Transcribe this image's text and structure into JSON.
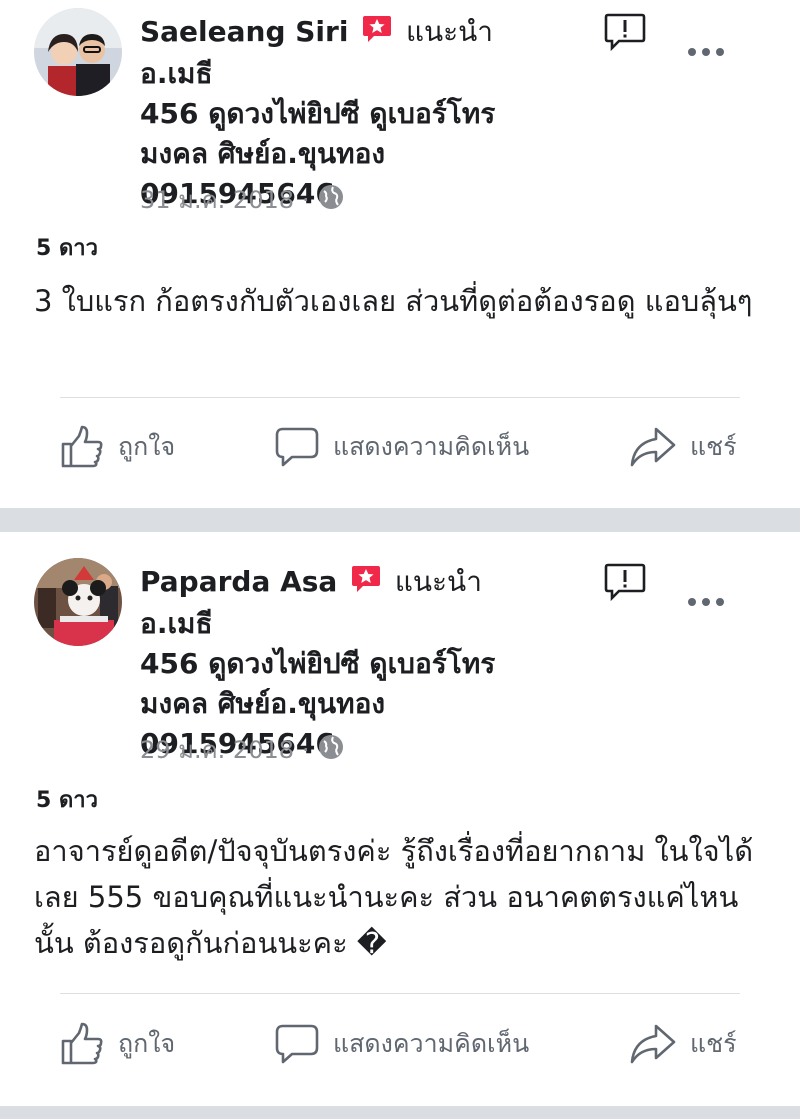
{
  "posts": [
    {
      "author": "Saeleang Siri",
      "recommend_word": "แนะนำ",
      "page_name_lines": [
        "อ.เมธี",
        "456 ดูดวงไพ่ยิปซี ดูเบอร์โทร",
        "มงคล ศิษย์อ.ขุนทอง",
        "0915945646"
      ],
      "date": "31 ม.ค. 2018",
      "separator": "·",
      "rating": "5 ดาว",
      "text": "3 ใบแรก ก้อตรงกับตัวเองเลย ส่วนที่ดูต่อต้องรอดู แอบลุ้นๆ",
      "actions": {
        "like": "ถูกใจ",
        "comment": "แสดงความคิดเห็น",
        "share": "แชร์"
      }
    },
    {
      "author": "Paparda Asa",
      "recommend_word": "แนะนำ",
      "page_name_lines": [
        "อ.เมธี",
        "456 ดูดวงไพ่ยิปซี ดูเบอร์โทร",
        "มงคล ศิษย์อ.ขุนทอง",
        "0915945646"
      ],
      "date": "29 ม.ค. 2018",
      "separator": "·",
      "rating": "5 ดาว",
      "text": "อาจารย์ดูอดีต/ปัจจุบันตรงค่ะ รู้ถึงเรื่องที่อยากถาม ในใจได้เลย 555 ขอบคุณที่แนะนำนะคะ ส่วน อนาคตตรงแค่ไหนนั้น ต้องรอดูกันก่อนนะคะ �",
      "actions": {
        "like": "ถูกใจ",
        "comment": "แสดงความคิดเห็น",
        "share": "แชร์"
      }
    }
  ],
  "colors": {
    "recommend_badge": "#f02849",
    "muted_text": "#8a8d91",
    "action_text": "#606770",
    "separator_bg": "#dadde1"
  },
  "icons": [
    "recommend-badge-icon",
    "report-icon",
    "more-options-icon",
    "globe-icon",
    "like-icon",
    "comment-icon",
    "share-icon"
  ]
}
